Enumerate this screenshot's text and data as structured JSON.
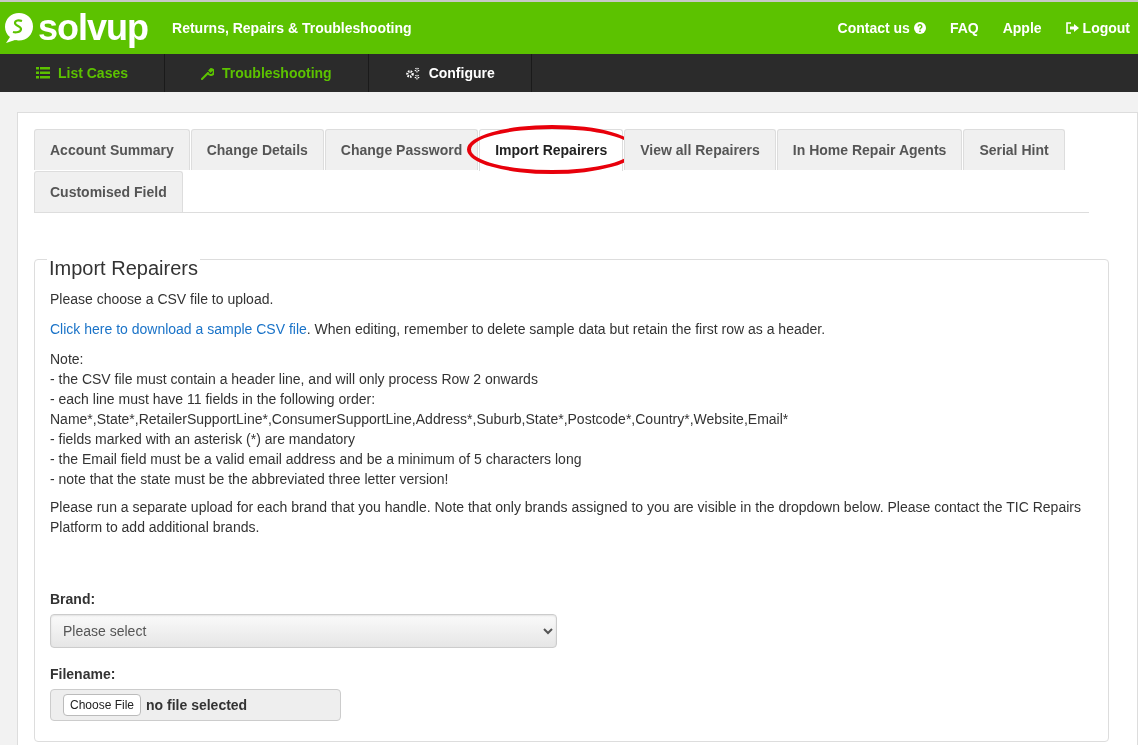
{
  "header": {
    "logo": "solvup",
    "tagline": "Returns, Repairs & Troubleshooting",
    "links": [
      {
        "label": "Contact us",
        "kind": "help"
      },
      {
        "label": "FAQ",
        "kind": "plain"
      },
      {
        "label": "Apple",
        "kind": "plain"
      },
      {
        "label": "Logout",
        "kind": "logout"
      }
    ]
  },
  "nav": [
    {
      "label": "List Cases",
      "kind": "list",
      "selected": false
    },
    {
      "label": "Troubleshooting",
      "kind": "wrench",
      "selected": false
    },
    {
      "label": "Configure",
      "kind": "gears",
      "selected": true
    }
  ],
  "tabs": [
    {
      "label": "Account Summary",
      "selected": false,
      "circled": false
    },
    {
      "label": "Change Details",
      "selected": false,
      "circled": false
    },
    {
      "label": "Change Password",
      "selected": false,
      "circled": false
    },
    {
      "label": "Import Repairers",
      "selected": true,
      "circled": true
    },
    {
      "label": "View all Repairers",
      "selected": false,
      "circled": false
    },
    {
      "label": "In Home Repair Agents",
      "selected": false,
      "circled": false
    },
    {
      "label": "Serial Hint",
      "selected": false,
      "circled": false
    },
    {
      "label": "Customised Field",
      "selected": false,
      "circled": false
    }
  ],
  "section": {
    "title": "Import Repairers",
    "intro": "Please choose a CSV file to upload.",
    "download": {
      "link": "Click here to download a sample CSV file",
      "text": ". When editing, remember to delete sample data but retain the first row as a header."
    },
    "note_lines": [
      "Note:",
      "- the CSV file must contain a header line, and will only process Row 2 onwards",
      "- each line must have 11 fields in the following order:",
      "Name*,State*,RetailerSupportLine*,ConsumerSupportLine,Address*,Suburb,State*,Postcode*,Country*,Website,Email*",
      "- fields marked with an asterisk (*) are mandatory",
      "- the Email field must be a valid email address and be a minimum of 5 characters long",
      "- note that the state must be the abbreviated three letter version!"
    ],
    "brands_note": "Please run a separate upload for each brand that you handle. Note that only brands assigned to you are visible in the dropdown below. Please contact the TIC Repairs Platform to add additional brands.",
    "brand": {
      "label": "Brand:",
      "value": "Please select"
    },
    "file": {
      "label": "Filename:",
      "button": "Choose File",
      "status": "no file selected"
    }
  }
}
